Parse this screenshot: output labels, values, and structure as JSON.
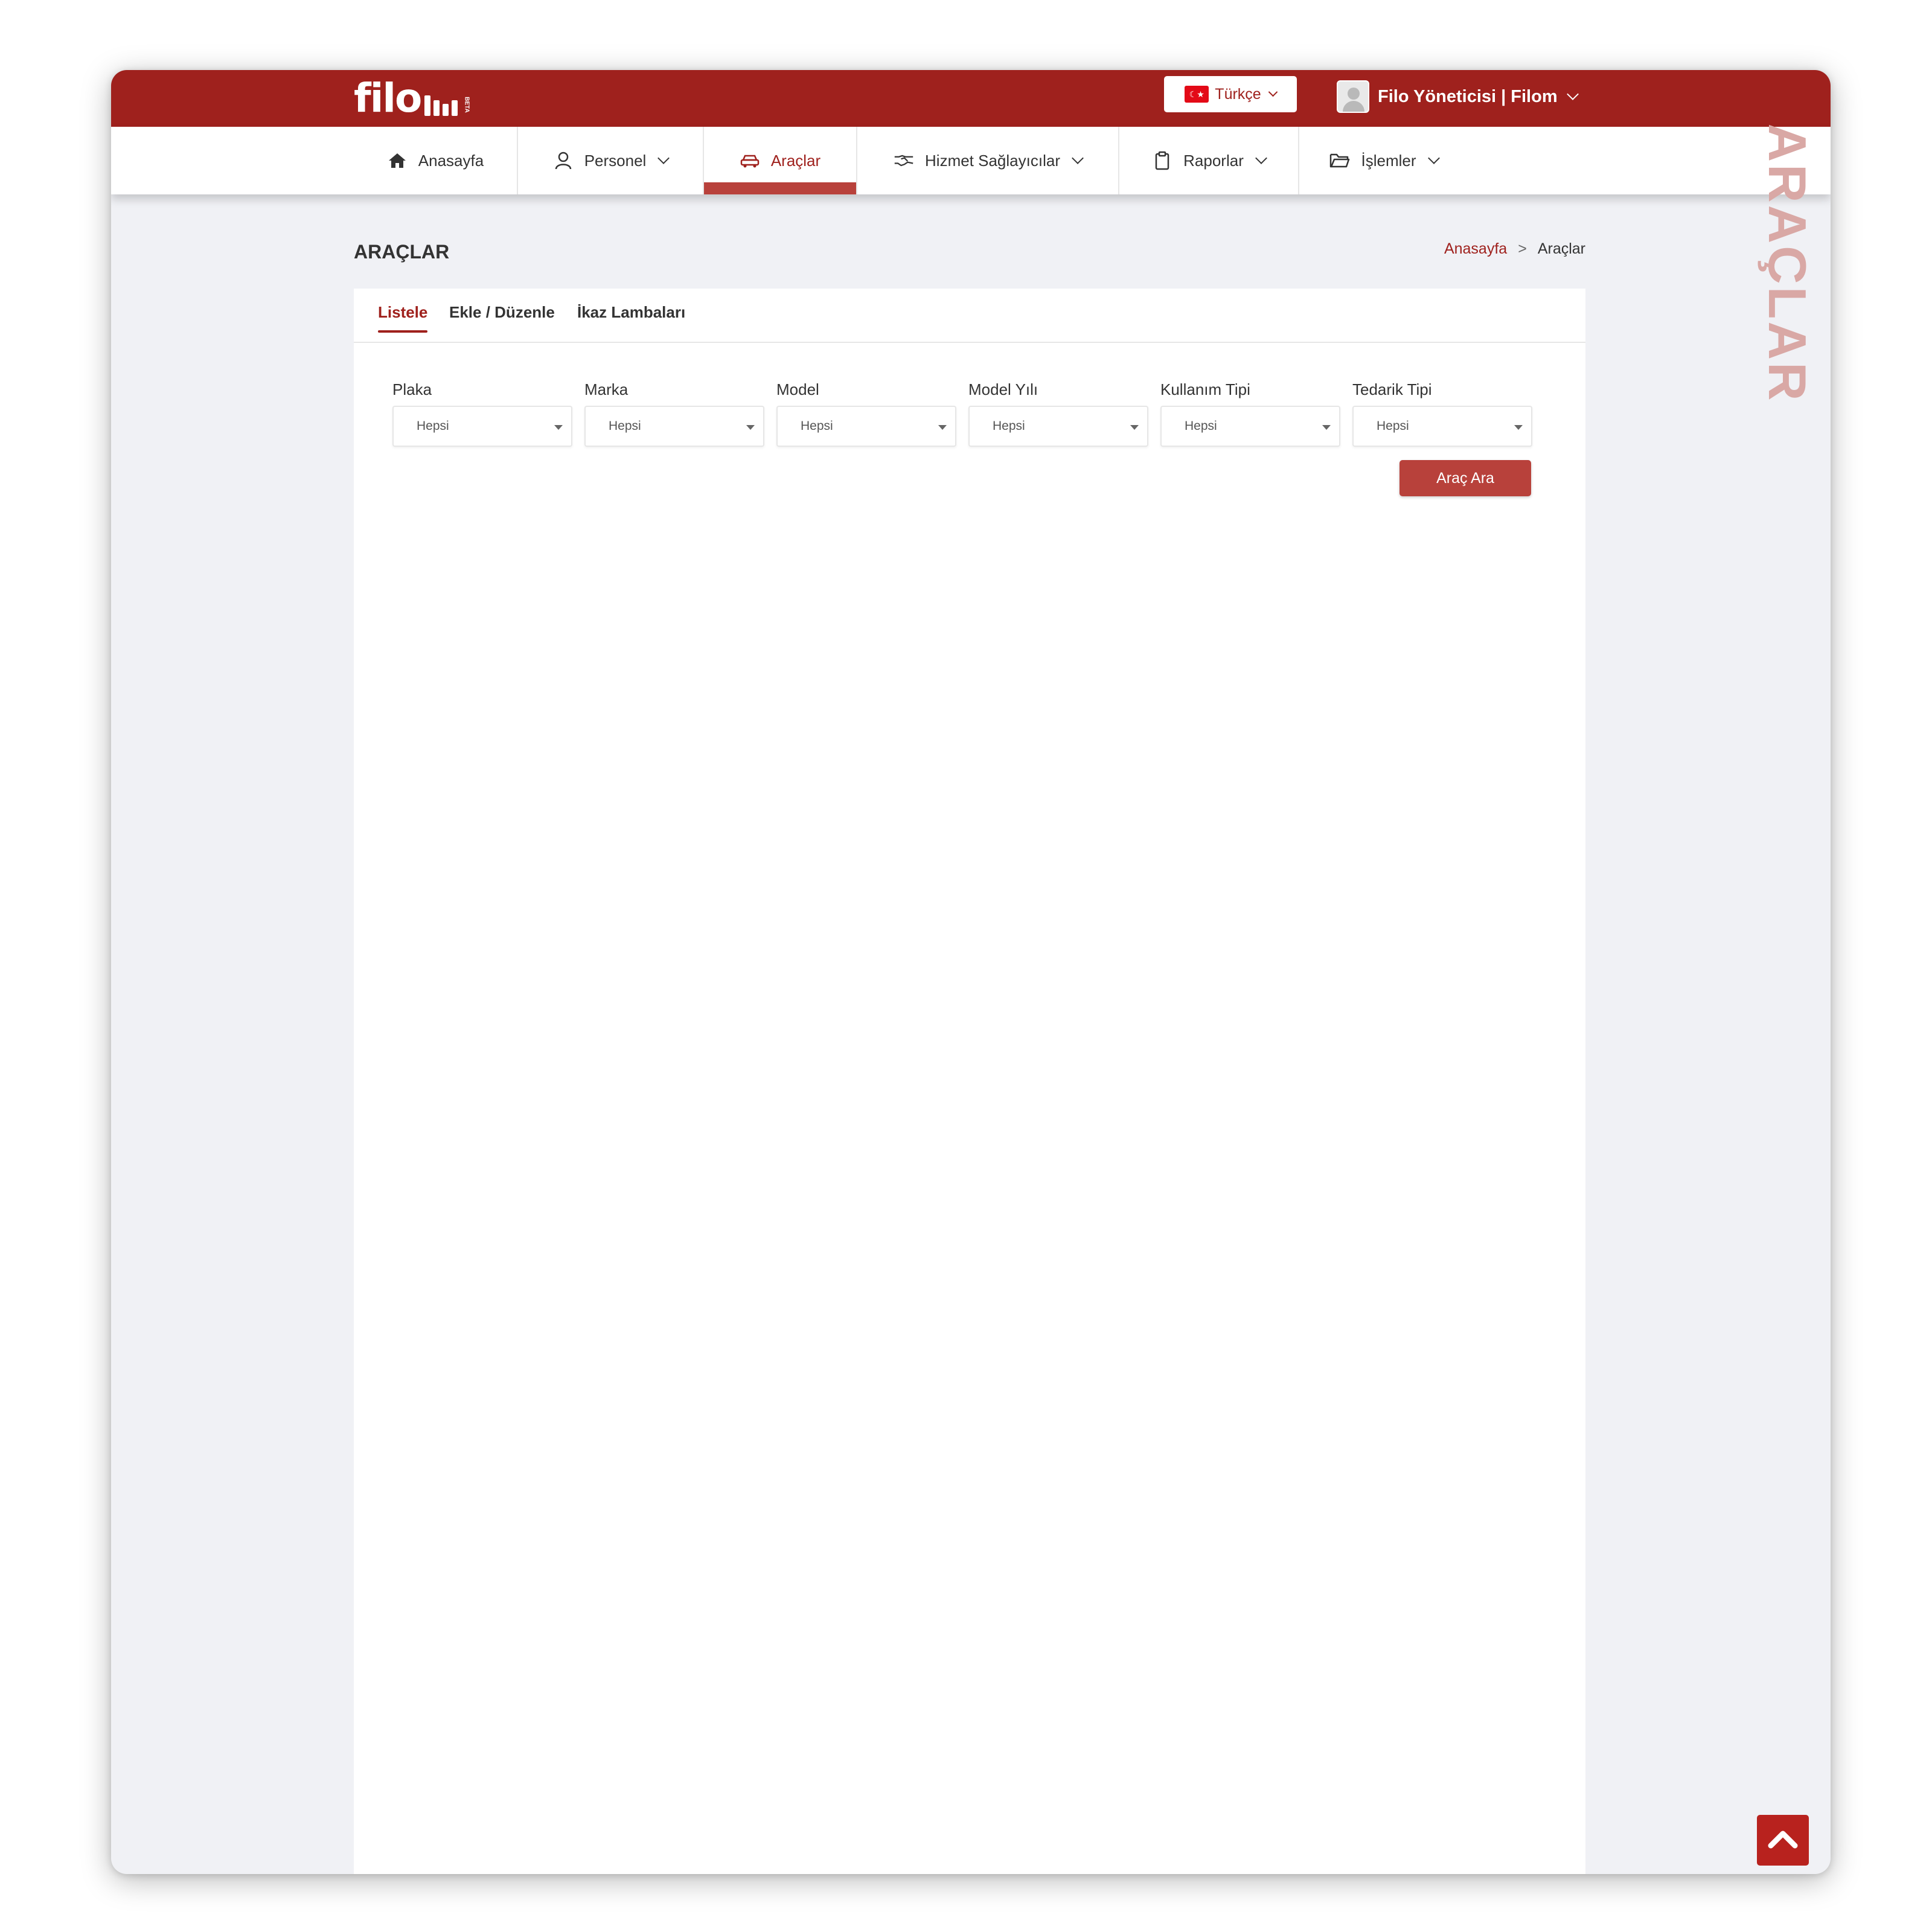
{
  "brand": {
    "logo_text": "filo",
    "logo_beta": "BETA"
  },
  "topbar": {
    "language": {
      "label": "Türkçe",
      "flag": "tr-flag",
      "flag_glyph": "☾★"
    },
    "user": {
      "label": "Filo Yöneticisi | Filom"
    }
  },
  "nav": {
    "items": [
      {
        "label": "Anasayfa",
        "icon": "home-icon"
      },
      {
        "label": "Personel",
        "icon": "user-icon",
        "dropdown": true
      },
      {
        "label": "Araçlar",
        "icon": "car-icon",
        "active": true
      },
      {
        "label": "Hizmet Sağlayıcılar",
        "icon": "handshake-icon",
        "dropdown": true
      },
      {
        "label": "Raporlar",
        "icon": "clipboard-icon",
        "dropdown": true
      },
      {
        "label": "İşlemler",
        "icon": "folder-icon",
        "dropdown": true
      }
    ]
  },
  "page": {
    "title": "ARAÇLAR",
    "vertical_title": "ARAÇLAR",
    "breadcrumb": {
      "home": "Anasayfa",
      "separator": ">",
      "current": "Araçlar"
    }
  },
  "tabs": [
    {
      "label": "Listele",
      "active": true
    },
    {
      "label": "Ekle / Düzenle"
    },
    {
      "label": "İkaz Lambaları"
    }
  ],
  "filters": [
    {
      "label": "Plaka",
      "value": "Hepsi"
    },
    {
      "label": "Marka",
      "value": "Hepsi"
    },
    {
      "label": "Model",
      "value": "Hepsi"
    },
    {
      "label": "Model Yılı",
      "value": "Hepsi"
    },
    {
      "label": "Kullanım Tipi",
      "value": "Hepsi"
    },
    {
      "label": "Tedarik Tipi",
      "value": "Hepsi"
    }
  ],
  "actions": {
    "search_label": "Araç Ara"
  },
  "colors": {
    "brand": "#9f211d",
    "accent": "#b8413b",
    "page_bg": "#f0f1f5"
  }
}
